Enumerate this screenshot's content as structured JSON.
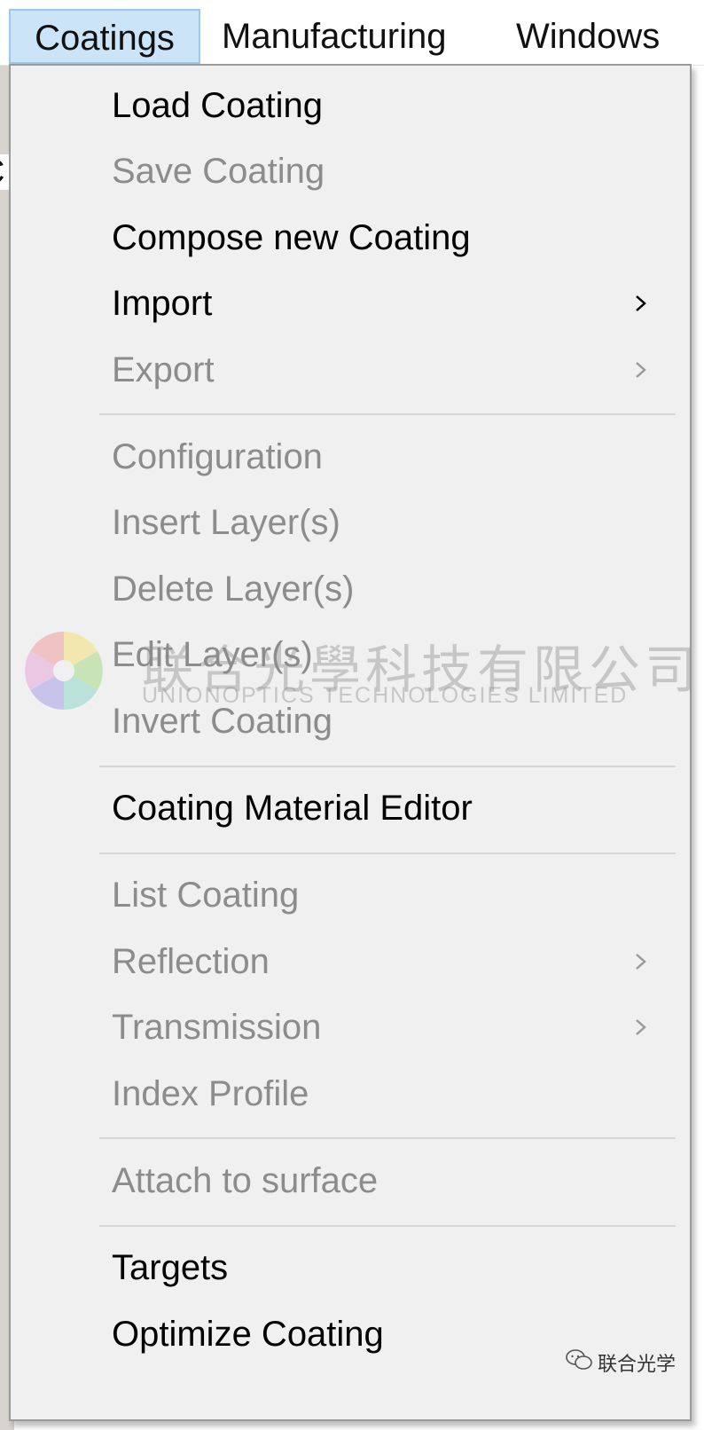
{
  "menubar": {
    "items": [
      {
        "label": "Coatings",
        "active": true
      },
      {
        "label": "Manufacturing",
        "active": false
      },
      {
        "label": "Windows",
        "active": false
      }
    ]
  },
  "menu": {
    "items": [
      {
        "label": "Load Coating",
        "enabled": true,
        "submenu": false
      },
      {
        "label": "Save Coating",
        "enabled": false,
        "submenu": false
      },
      {
        "label": "Compose new Coating",
        "enabled": true,
        "submenu": false
      },
      {
        "label": "Import",
        "enabled": true,
        "submenu": true
      },
      {
        "label": "Export",
        "enabled": false,
        "submenu": true
      },
      {
        "label": "Configuration",
        "enabled": false,
        "submenu": false
      },
      {
        "label": "Insert Layer(s)",
        "enabled": false,
        "submenu": false
      },
      {
        "label": "Delete Layer(s)",
        "enabled": false,
        "submenu": false
      },
      {
        "label": "Edit Layer(s)",
        "enabled": false,
        "submenu": false
      },
      {
        "label": "Invert Coating",
        "enabled": false,
        "submenu": false
      },
      {
        "label": "Coating Material Editor",
        "enabled": true,
        "submenu": false
      },
      {
        "label": "List Coating",
        "enabled": false,
        "submenu": false
      },
      {
        "label": "Reflection",
        "enabled": false,
        "submenu": true
      },
      {
        "label": "Transmission",
        "enabled": false,
        "submenu": true
      },
      {
        "label": "Index Profile",
        "enabled": false,
        "submenu": false
      },
      {
        "label": "Attach to surface",
        "enabled": false,
        "submenu": false
      },
      {
        "label": "Targets",
        "enabled": true,
        "submenu": false
      },
      {
        "label": "Optimize Coating",
        "enabled": true,
        "submenu": false
      }
    ]
  },
  "watermark": {
    "cn": "联合光學科技有限公司",
    "en": "UNIONOPTICS TECHNOLOGIES LIMITED"
  },
  "wechat_label": "联合光学",
  "background_clip_text": "C",
  "colors": {
    "menu_bg": "#f0f0f0",
    "active_tab_bg": "#cce4f7",
    "active_tab_border": "#99c9ef",
    "enabled_text": "#000000",
    "disabled_text": "#8c8c8c"
  }
}
